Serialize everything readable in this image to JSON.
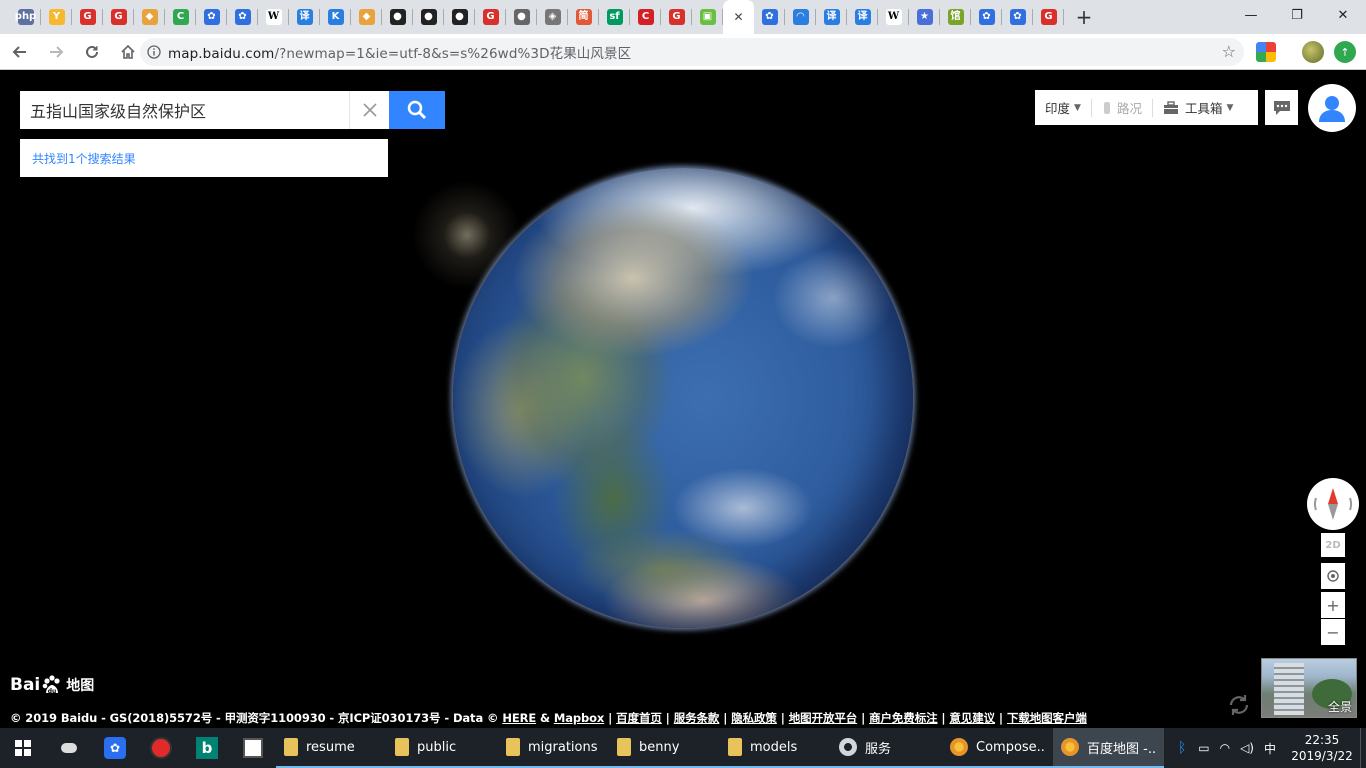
{
  "browser": {
    "tabs": [
      {
        "icon": "php-icon",
        "text": "php",
        "color": "#5e6fa0"
      },
      {
        "icon": "y-icon",
        "text": "Y",
        "color": "#f5b82e"
      },
      {
        "icon": "g-red-icon",
        "text": "G",
        "color": "#d9302b"
      },
      {
        "icon": "g-red-icon",
        "text": "G",
        "color": "#d9302b"
      },
      {
        "icon": "box-icon",
        "text": "◆",
        "color": "#e8a33d"
      },
      {
        "icon": "c-green-icon",
        "text": "C",
        "color": "#2fa84f"
      },
      {
        "icon": "baidu-paw-icon",
        "text": "✿",
        "color": "#2f6fe0"
      },
      {
        "icon": "baidu-paw-icon",
        "text": "✿",
        "color": "#2f6fe0"
      },
      {
        "icon": "wikipedia-icon",
        "text": "W",
        "color": "#ffffff"
      },
      {
        "icon": "translate-icon",
        "text": "译",
        "color": "#2a7de1"
      },
      {
        "icon": "k-icon",
        "text": "K",
        "color": "#2a7de1"
      },
      {
        "icon": "box-icon",
        "text": "◆",
        "color": "#e8a33d"
      },
      {
        "icon": "github-icon",
        "text": "●",
        "color": "#222222"
      },
      {
        "icon": "github-icon",
        "text": "●",
        "color": "#222222"
      },
      {
        "icon": "github-icon",
        "text": "●",
        "color": "#222222"
      },
      {
        "icon": "g-red-icon",
        "text": "G",
        "color": "#d9302b"
      },
      {
        "icon": "globe-icon",
        "text": "●",
        "color": "#666666"
      },
      {
        "icon": "shield-icon",
        "text": "◈",
        "color": "#777777"
      },
      {
        "icon": "jian-icon",
        "text": "简",
        "color": "#e05a3a"
      },
      {
        "icon": "sf-icon",
        "text": "sf",
        "color": "#009a61"
      },
      {
        "icon": "c-red-icon",
        "text": "C",
        "color": "#d41f26"
      },
      {
        "icon": "g-red-icon",
        "text": "G",
        "color": "#d9302b"
      },
      {
        "icon": "green-app-icon",
        "text": "▣",
        "color": "#6abf40"
      },
      {
        "icon": "close-icon",
        "text": "✕",
        "color": "#444444",
        "active": true
      },
      {
        "icon": "baidu-paw-icon",
        "text": "✿",
        "color": "#2f6fe0"
      },
      {
        "icon": "refresh-blue-icon",
        "text": "◠",
        "color": "#2a7de1"
      },
      {
        "icon": "translate-icon",
        "text": "译",
        "color": "#2a7de1"
      },
      {
        "icon": "translate-icon",
        "text": "译",
        "color": "#2a7de1"
      },
      {
        "icon": "wikipedia-icon",
        "text": "W",
        "color": "#ffffff"
      },
      {
        "icon": "star-blue-icon",
        "text": "★",
        "color": "#4a6fd8"
      },
      {
        "icon": "guan-icon",
        "text": "馆",
        "color": "#7aa32a"
      },
      {
        "icon": "baidu-paw-icon",
        "text": "✿",
        "color": "#2f6fe0"
      },
      {
        "icon": "baidu-paw-icon",
        "text": "✿",
        "color": "#2f6fe0"
      },
      {
        "icon": "g-red-icon",
        "text": "G",
        "color": "#d9302b"
      }
    ],
    "new_tab": "+",
    "window_controls": {
      "minimize": "—",
      "restore": "❐",
      "close": "✕"
    },
    "url_host": "map.baidu.com",
    "url_path": "/?newmap=1&ie=utf-8&s=s%26wd%3D花果山风景区"
  },
  "map": {
    "search_value": "五指山国家级自然保护区",
    "results_text": "共找到1个搜索结果",
    "city": "印度",
    "traffic": "路况",
    "toolbox": "工具箱",
    "btn_2d": "2D",
    "zoom_in": "+",
    "zoom_out": "−",
    "pano_label": "全景",
    "logo_bai": "Bai",
    "logo_du": "du",
    "logo_map": "地图",
    "copyright_prefix": "© 2019 Baidu - GS(2018)5572号 - 甲测资字1100930 - 京ICP证030173号 - Data © ",
    "link_here": "HERE",
    "amp": " & ",
    "link_mapbox": "Mapbox",
    "footer_links": [
      "百度首页",
      "服务条款",
      "隐私政策",
      "地图开放平台",
      "商户免费标注",
      "意见建议",
      "下载地图客户端"
    ]
  },
  "taskbar": {
    "apps": [
      {
        "label": "resume",
        "icon": "folder-icon"
      },
      {
        "label": "public",
        "icon": "folder-icon"
      },
      {
        "label": "migrations",
        "icon": "folder-icon"
      },
      {
        "label": "benny",
        "icon": "folder-icon"
      },
      {
        "label": "models",
        "icon": "folder-icon"
      },
      {
        "label": "服务",
        "icon": "gear-icon"
      },
      {
        "label": "Compose...",
        "icon": "chrome-icon"
      },
      {
        "label": "百度地图 -...",
        "icon": "chrome-icon",
        "active": true
      }
    ],
    "ime": "中",
    "time": "22:35",
    "date": "2019/3/22"
  }
}
